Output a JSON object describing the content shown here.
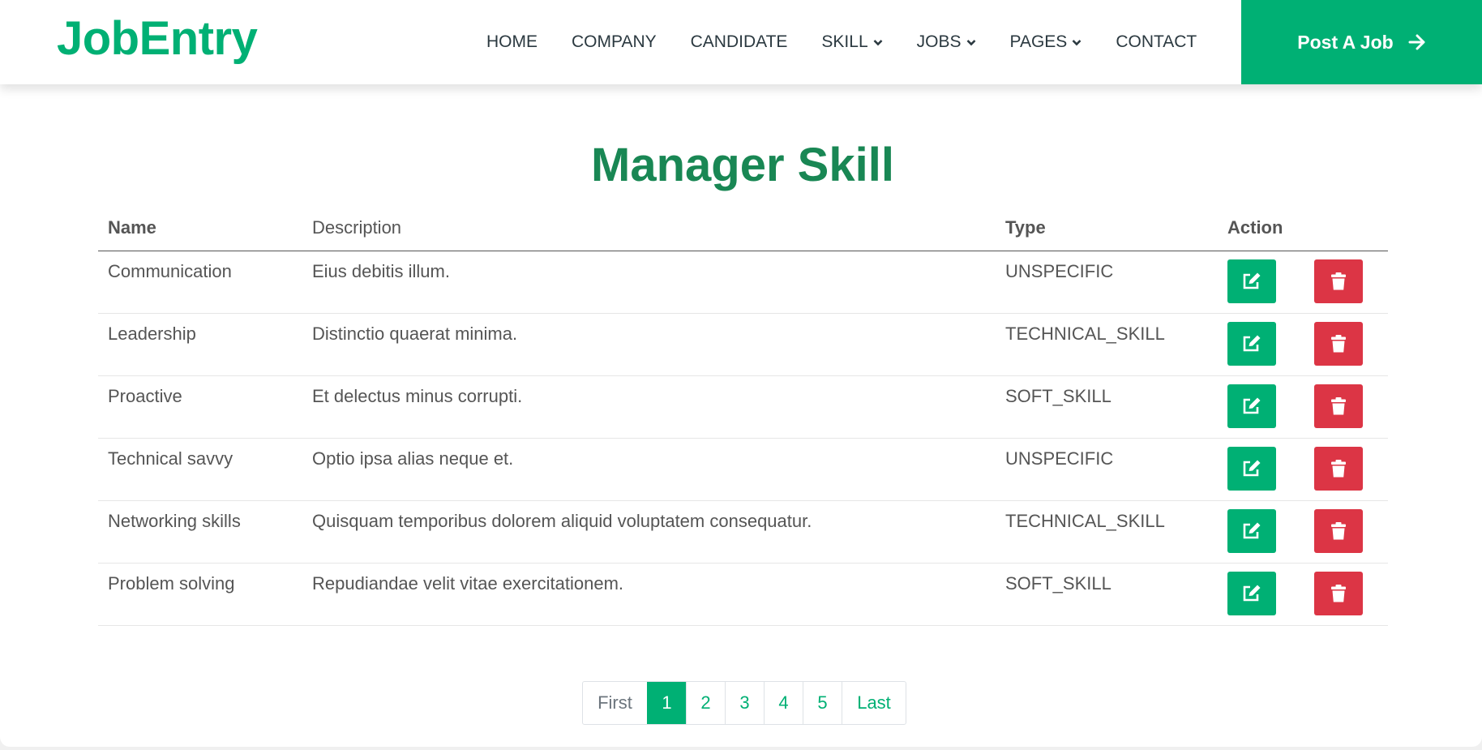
{
  "colors": {
    "brand": "#00b074",
    "title": "#198754",
    "danger": "#dc3545"
  },
  "navbar": {
    "brand": "JobEntry",
    "items": [
      {
        "label": "HOME",
        "dropdown": false
      },
      {
        "label": "COMPANY",
        "dropdown": false
      },
      {
        "label": "CANDIDATE",
        "dropdown": false
      },
      {
        "label": "SKILL",
        "dropdown": true
      },
      {
        "label": "JOBS",
        "dropdown": true
      },
      {
        "label": "PAGES",
        "dropdown": true
      },
      {
        "label": "CONTACT",
        "dropdown": false
      }
    ],
    "cta": "Post A Job",
    "cta_icon": "arrow-right-icon"
  },
  "main": {
    "title": "Manager Skill",
    "table": {
      "headers": {
        "name": "Name",
        "description": "Description",
        "type": "Type",
        "action": "Action"
      },
      "rows": [
        {
          "name": "Communication",
          "description": "Eius debitis illum.",
          "type": "UNSPECIFIC"
        },
        {
          "name": "Leadership",
          "description": "Distinctio quaerat minima.",
          "type": "TECHNICAL_SKILL"
        },
        {
          "name": "Proactive",
          "description": "Et delectus minus corrupti.",
          "type": "SOFT_SKILL"
        },
        {
          "name": "Technical savvy",
          "description": "Optio ipsa alias neque et.",
          "type": "UNSPECIFIC"
        },
        {
          "name": "Networking skills",
          "description": "Quisquam temporibus dolorem aliquid voluptatem consequatur.",
          "type": "TECHNICAL_SKILL"
        },
        {
          "name": "Problem solving",
          "description": "Repudiandae velit vitae exercitationem.",
          "type": "SOFT_SKILL"
        }
      ],
      "edit_icon": "edit-icon",
      "delete_icon": "trash-icon"
    },
    "pagination": {
      "first": "First",
      "pages": [
        "1",
        "2",
        "3",
        "4",
        "5"
      ],
      "active": "1",
      "last": "Last"
    }
  }
}
